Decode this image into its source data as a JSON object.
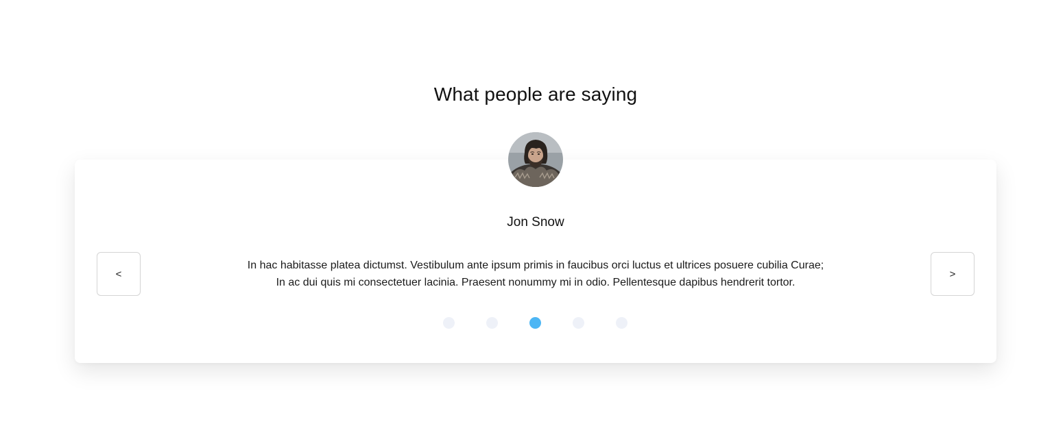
{
  "section": {
    "title": "What people are saying"
  },
  "testimonial": {
    "name": "Jon Snow",
    "quote_line_1": "In hac habitasse platea dictumst. Vestibulum ante ipsum primis in faucibus orci luctus et ultrices posuere cubilia Curae;",
    "quote_line_2": "In ac dui quis mi consectetuer lacinia. Praesent nonummy mi in odio. Pellentesque dapibus hendrerit tortor."
  },
  "controls": {
    "prev_label": "<",
    "next_label": ">"
  },
  "pagination": {
    "count": 5,
    "active_index": 2
  },
  "colors": {
    "accent": "#4db6f4",
    "dot_inactive": "#eef1f8",
    "button_border": "#d4d4d4"
  }
}
